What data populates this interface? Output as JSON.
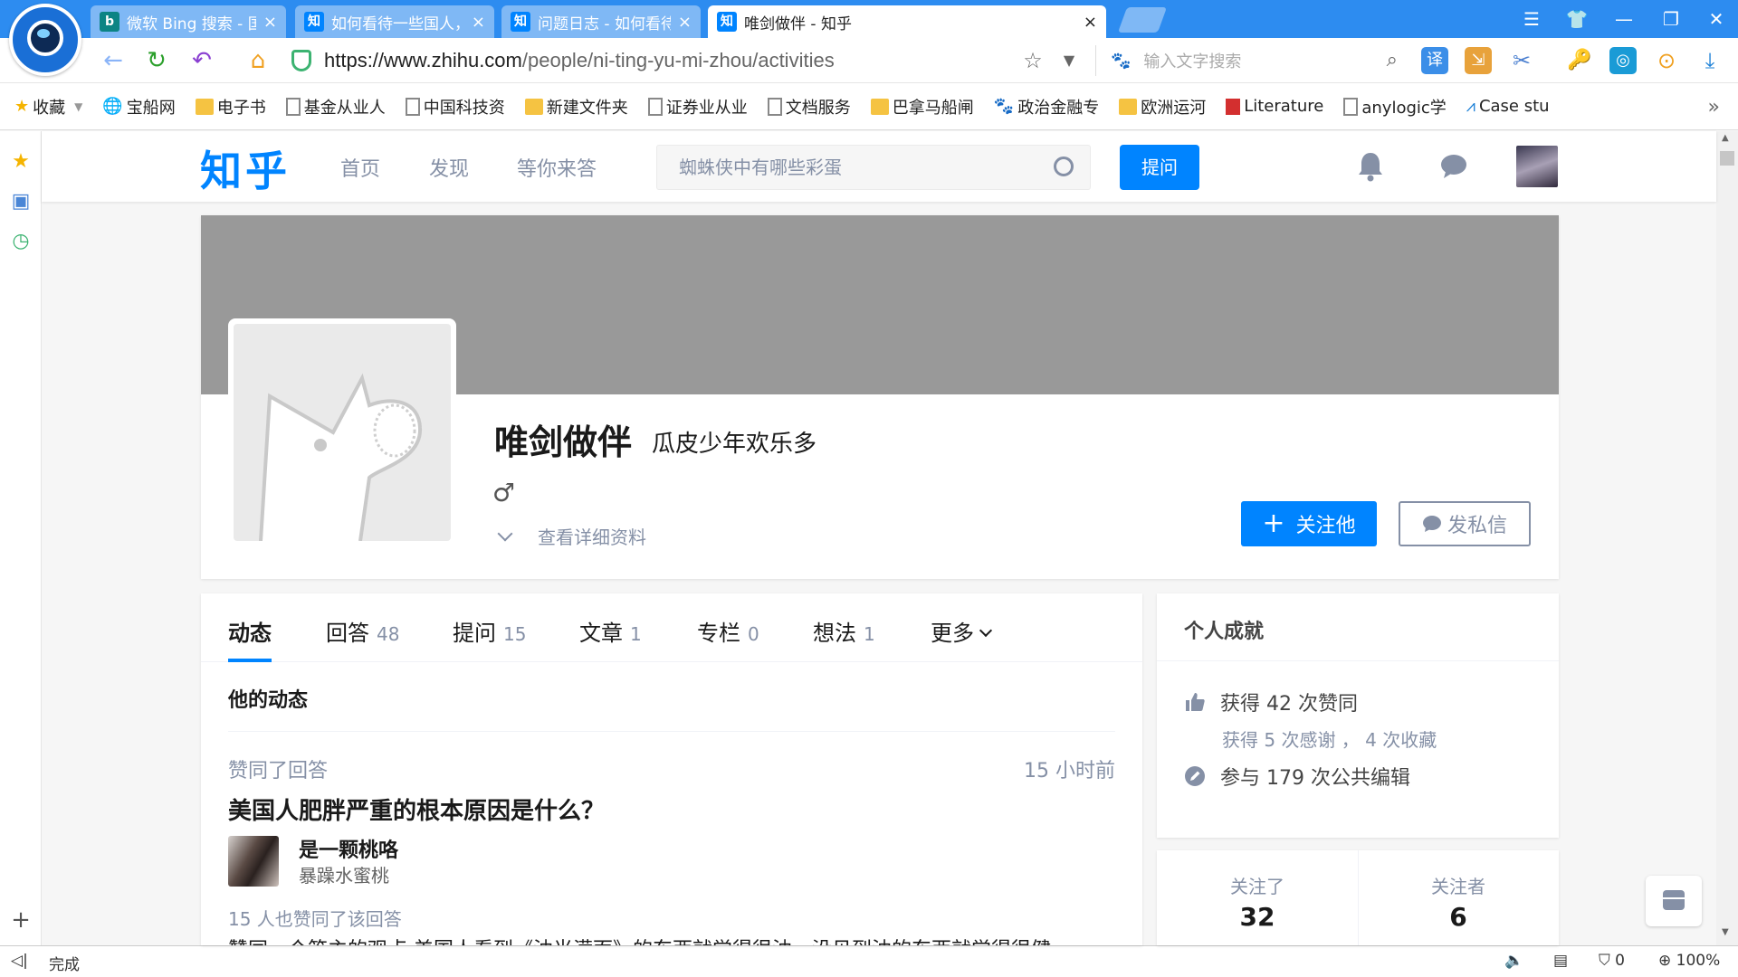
{
  "browser": {
    "tabs": [
      {
        "title": "微软 Bing 搜索 - 国际版",
        "favicon": "b",
        "favicon_color": "#0c8484",
        "active": false
      },
      {
        "title": "如何看待一些国人，对于",
        "favicon": "知",
        "favicon_color": "#0084ff",
        "active": false
      },
      {
        "title": "问题日志 - 如何看待一些",
        "favicon": "知",
        "favicon_color": "#0084ff",
        "active": false
      },
      {
        "title": "唯剑做伴 - 知乎",
        "favicon": "知",
        "favicon_color": "#0084ff",
        "active": true
      }
    ],
    "tab_close": "×",
    "url_host": "https://www.zhihu.com",
    "url_path": "/people/ni-ting-yu-mi-zhou/activities",
    "search_placeholder": "输入文字搜索",
    "bookmarks": [
      {
        "label": "收藏",
        "icon": "star-icon"
      },
      {
        "label": "宝船网",
        "icon": "globe-icon"
      },
      {
        "label": "电子书",
        "icon": "folder-icon"
      },
      {
        "label": "基金从业人",
        "icon": "page-icon"
      },
      {
        "label": "中国科技资",
        "icon": "page-icon"
      },
      {
        "label": "新建文件夹",
        "icon": "folder-icon"
      },
      {
        "label": "证券业从业",
        "icon": "page-icon"
      },
      {
        "label": "文档服务",
        "icon": "page-icon"
      },
      {
        "label": "巴拿马船闸",
        "icon": "folder-icon"
      },
      {
        "label": "政治金融专",
        "icon": "paw-icon"
      },
      {
        "label": "欧洲运河",
        "icon": "folder-icon"
      },
      {
        "label": "Literature",
        "icon": "lit-icon"
      },
      {
        "label": "anylogic学",
        "icon": "page-icon"
      },
      {
        "label": "Case stu",
        "icon": "case-icon"
      }
    ],
    "bookmarks_more": "»",
    "status_text": "完成",
    "status_counter": "0",
    "zoom": "100%",
    "accent": "#2d8cf0"
  },
  "zhihu": {
    "logo": "知乎",
    "nav": [
      "首页",
      "发现",
      "等你来答"
    ],
    "search_placeholder": "蜘蛛侠中有哪些彩蛋",
    "ask_button": "提问",
    "profile": {
      "name": "唯剑做伴",
      "headline": "瓜皮少年欢乐多",
      "gender": "♂",
      "detail_link": "查看详细资料",
      "follow_button": "关注他",
      "message_button": "发私信"
    },
    "tabs": [
      {
        "label": "动态",
        "count": ""
      },
      {
        "label": "回答",
        "count": "48"
      },
      {
        "label": "提问",
        "count": "15"
      },
      {
        "label": "文章",
        "count": "1"
      },
      {
        "label": "专栏",
        "count": "0"
      },
      {
        "label": "想法",
        "count": "1"
      },
      {
        "label": "更多",
        "count": ""
      }
    ],
    "feed_heading": "他的动态",
    "activity": {
      "type": "赞同了回答",
      "time": "15 小时前",
      "title": "美国人肥胖严重的根本原因是什么？",
      "author": "是一颗桃咯",
      "author_bio": "暴躁水蜜桃",
      "likes": "15 人也赞同了该回答",
      "excerpt": "赞同一个答主的观点 美国人看到《油光满面》的东西就觉得很油，没见到油的东西就觉得很健"
    },
    "achievements": {
      "title": "个人成就",
      "upvotes": "获得 42 次赞同",
      "thanks": "获得 5 次感谢 ， 4 次收藏",
      "edits": "参与 179 次公共编辑"
    },
    "following": {
      "label": "关注了",
      "value": "32"
    },
    "followers": {
      "label": "关注者",
      "value": "6"
    },
    "brand_color": "#0084ff"
  }
}
